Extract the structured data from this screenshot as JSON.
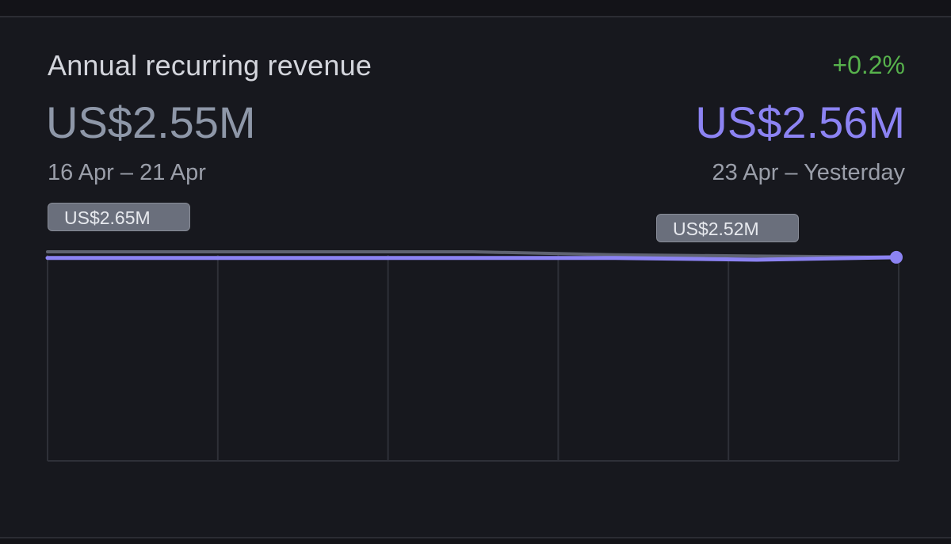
{
  "card": {
    "title": "Annual recurring revenue",
    "previous": {
      "value": "US$2.55M",
      "range": "16 Apr – 21 Apr"
    },
    "current": {
      "change": "+0.2%",
      "value": "US$2.56M",
      "range": "23 Apr – Yesterday"
    }
  },
  "colors": {
    "background": "#131318",
    "card": "#17181e",
    "previous_value": "#8e97a8",
    "current_series": "#8c83f3",
    "change_positive": "#57b24c",
    "grid": "#2e3038",
    "tooltip": "#6a6f7c"
  },
  "chart_data": {
    "type": "line",
    "series": [
      {
        "values": [
          2.65,
          2.65,
          2.65,
          2.65,
          2.6,
          2.58,
          2.56
        ]
      },
      {
        "values": [
          2.55,
          2.55,
          2.55,
          2.55,
          2.55,
          2.52,
          2.56
        ]
      }
    ],
    "annotations": [
      {
        "text": "US$2.65M",
        "kind": "max"
      },
      {
        "text": "US$2.52M",
        "kind": "min"
      }
    ],
    "vertical_gridlines": 6,
    "grid": true
  }
}
